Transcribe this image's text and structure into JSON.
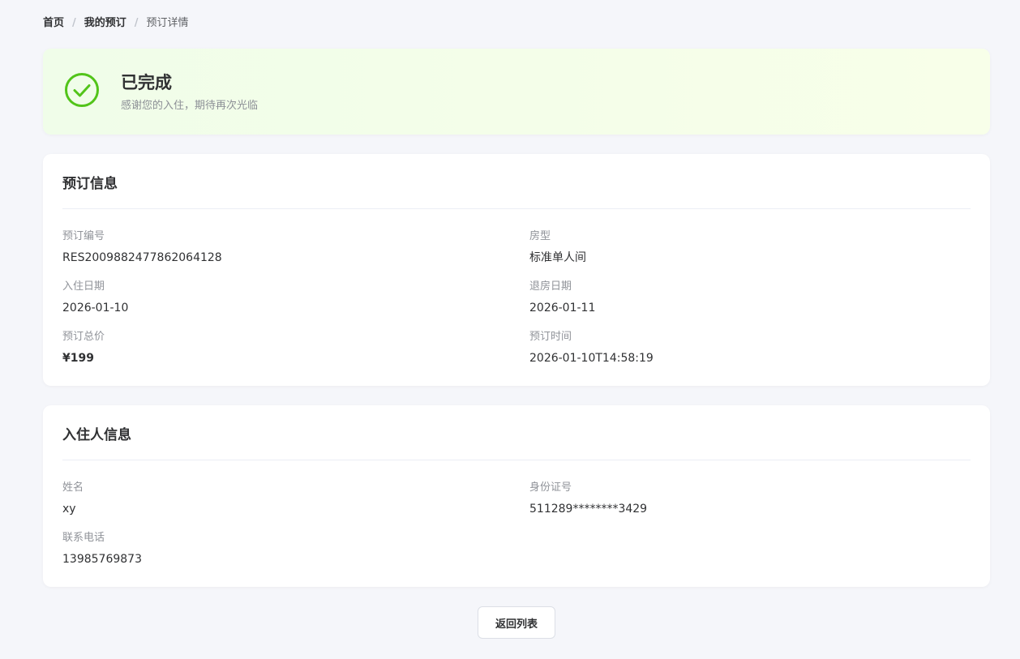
{
  "breadcrumb": {
    "home": "首页",
    "my_bookings": "我的预订",
    "current": "预订详情",
    "separator": "/"
  },
  "status": {
    "title": "已完成",
    "subtitle": "感谢您的入住，期待再次光临",
    "icon": "check-circle-icon",
    "color": "#52c41a"
  },
  "booking_info": {
    "title": "预订信息",
    "fields": {
      "booking_no": {
        "label": "预订编号",
        "value": "RES2009882477862064128"
      },
      "room_type": {
        "label": "房型",
        "value": "标准单人间"
      },
      "checkin_date": {
        "label": "入住日期",
        "value": "2026-01-10"
      },
      "checkout_date": {
        "label": "退房日期",
        "value": "2026-01-11"
      },
      "total_price": {
        "label": "预订总价",
        "value": "¥199"
      },
      "booking_time": {
        "label": "预订时间",
        "value": "2026-01-10T14:58:19"
      }
    }
  },
  "guest_info": {
    "title": "入住人信息",
    "fields": {
      "name": {
        "label": "姓名",
        "value": "xy"
      },
      "id_number": {
        "label": "身份证号",
        "value": "511289********3429"
      },
      "phone": {
        "label": "联系电话",
        "value": "13985769873"
      }
    }
  },
  "actions": {
    "back_label": "返回列表"
  }
}
